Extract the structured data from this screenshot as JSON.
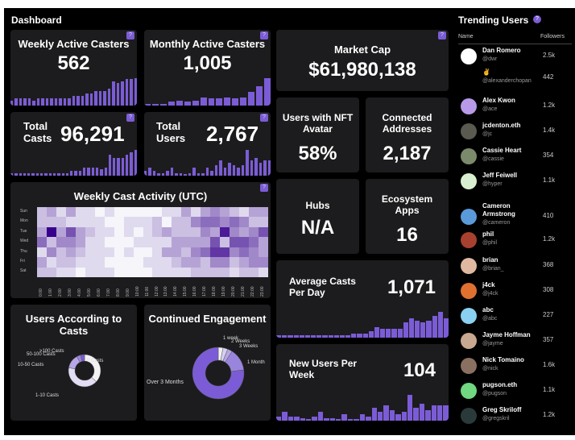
{
  "title": "Dashboard",
  "accent": "#7b5cd6",
  "help_label": "?",
  "cards": {
    "weekly_active": {
      "label": "Weekly Active Casters",
      "value": "562",
      "bars": [
        2,
        3,
        3,
        3,
        3,
        2,
        3,
        3,
        3,
        3,
        3,
        3,
        3,
        3,
        4,
        4,
        4,
        5,
        5,
        6,
        6,
        6,
        7,
        10,
        9.5,
        10,
        11,
        11,
        11.5
      ]
    },
    "monthly_active": {
      "label": "Monthly Active Casters",
      "value": "1,005",
      "bars": [
        0.1,
        0.1,
        0.1,
        1,
        1.2,
        1,
        1.2,
        2,
        1.8,
        1.8,
        2,
        1.8,
        2,
        3.5,
        5,
        7
      ]
    },
    "total_casts": {
      "label": "Total Casts",
      "value": "96,291",
      "bars": [
        1,
        1,
        1,
        1,
        1,
        1,
        1,
        1,
        1,
        1,
        1,
        1,
        1,
        1,
        2,
        2,
        2,
        3,
        3,
        3,
        3,
        2.5,
        3,
        8,
        7,
        7,
        7,
        8,
        9,
        10
      ]
    },
    "total_users": {
      "label": "Total Users",
      "value": "2,767",
      "bars": [
        2,
        3,
        2,
        1,
        1,
        2,
        3,
        1,
        1,
        0.3,
        1,
        3,
        1,
        1,
        3,
        2,
        4,
        6,
        3,
        5,
        4,
        3,
        4,
        10,
        6,
        7,
        5,
        6,
        6
      ]
    },
    "market_cap": {
      "label": "Market Cap",
      "value": "$61,980,138"
    },
    "nft_avatar": {
      "label": "Users with NFT Avatar",
      "value": "58%"
    },
    "connected": {
      "label": "Connected Addresses",
      "value": "2,187"
    },
    "hubs": {
      "label": "Hubs",
      "value": "N/A"
    },
    "eco_apps": {
      "label": "Ecosystem Apps",
      "value": "16"
    },
    "avg_casts": {
      "label": "Average Casts Per Day",
      "value": "1,071",
      "bars": [
        1,
        1,
        1,
        1,
        1,
        1,
        1,
        1,
        1,
        1,
        1,
        1,
        1,
        2,
        2,
        2,
        3,
        5,
        4,
        4,
        4,
        4,
        7,
        9,
        8,
        7,
        8,
        10,
        12,
        9
      ]
    },
    "new_users": {
      "label": "New Users Per Week",
      "value": "104",
      "bars": [
        2,
        4,
        2,
        2,
        1,
        0.5,
        2,
        4,
        1,
        1,
        0.3,
        3,
        0.5,
        0.5,
        3,
        2,
        6,
        4,
        7,
        5,
        3,
        4,
        12,
        6,
        8,
        5,
        7,
        7,
        7
      ]
    }
  },
  "chart_data": [
    {
      "type": "heatmap",
      "title": "Weekly Cast Activity (UTC)",
      "rows": [
        "Sun",
        "Mon",
        "Tue",
        "Wed",
        "Thu",
        "Fri",
        "Sat"
      ],
      "columns": [
        "0:00",
        "1:00",
        "2:00",
        "3:00",
        "4:00",
        "5:00",
        "6:00",
        "7:00",
        "8:00",
        "9:00",
        "10:00",
        "11:00",
        "12:00",
        "13:00",
        "14:00",
        "15:00",
        "16:00",
        "17:00",
        "18:00",
        "19:00",
        "20:00",
        "21:00",
        "22:00",
        "23:00"
      ],
      "values": [
        [
          2,
          3,
          1,
          3,
          1,
          1,
          0,
          1,
          0,
          0,
          0,
          0,
          0,
          1,
          1,
          3,
          1,
          3,
          4,
          3,
          2,
          1,
          3,
          3
        ],
        [
          2,
          2,
          2,
          1,
          1,
          1,
          1,
          0,
          0,
          1,
          1,
          1,
          2,
          0,
          2,
          2,
          4,
          5,
          5,
          4,
          5,
          4,
          2,
          2
        ],
        [
          3,
          9,
          3,
          6,
          3,
          2,
          1,
          1,
          0,
          1,
          0,
          1,
          2,
          3,
          2,
          2,
          2,
          4,
          3,
          8,
          4,
          3,
          4,
          6
        ],
        [
          5,
          2,
          4,
          4,
          3,
          1,
          1,
          0,
          0,
          0,
          1,
          1,
          1,
          1,
          3,
          3,
          3,
          3,
          6,
          2,
          6,
          6,
          5,
          3
        ],
        [
          1,
          4,
          2,
          3,
          2,
          1,
          1,
          1,
          0,
          1,
          0,
          0,
          1,
          3,
          3,
          2,
          4,
          5,
          7,
          7,
          4,
          5,
          4,
          3
        ],
        [
          3,
          1,
          2,
          2,
          1,
          1,
          1,
          0,
          0,
          0,
          0,
          1,
          1,
          1,
          2,
          3,
          3,
          2,
          4,
          4,
          2,
          3,
          4,
          4
        ],
        [
          2,
          2,
          1,
          1,
          0,
          1,
          1,
          1,
          0,
          0,
          0,
          0,
          1,
          1,
          1,
          1,
          2,
          2,
          2,
          2,
          1,
          2,
          2,
          1
        ]
      ]
    },
    {
      "type": "pie",
      "title": "Users According to Casts",
      "categories": [
        "0 Casts",
        "1-10 Casts",
        "10-50 Casts",
        "50-100 Casts",
        ">100 Casts"
      ],
      "values": [
        37,
        41,
        14,
        4,
        4
      ],
      "colors": [
        "#f2f2f4",
        "#e2dcf5",
        "#b7a6e6",
        "#9a85dc",
        "#7b5cd6"
      ]
    },
    {
      "type": "pie",
      "title": "Continued Engagement",
      "categories": [
        "1 week",
        "2 Weeks",
        "3 Weeks",
        "1 Month",
        "Over 3 Months"
      ],
      "values": [
        3,
        3,
        3,
        14,
        77
      ],
      "colors": [
        "#f2f2f4",
        "#d8cff2",
        "#b7a6e6",
        "#9a85dc",
        "#7b5cd6"
      ]
    }
  ],
  "trending": {
    "title": "Trending Users",
    "col_name": "Name",
    "col_followers": "Followers",
    "users": [
      {
        "name": "Dan Romero",
        "handle": "@dwr",
        "followers": "2.5k",
        "color": "#ffffff"
      },
      {
        "name": "✌",
        "handle": "@alexanderchopan",
        "followers": "442",
        "color": "#000000"
      },
      {
        "name": "Alex Kwon",
        "handle": "@ace",
        "followers": "1.2k",
        "color": "#b89ae8"
      },
      {
        "name": "jcdenton.eth",
        "handle": "@jc",
        "followers": "1.4k",
        "color": "#5a5a50"
      },
      {
        "name": "Cassie Heart",
        "handle": "@cassie",
        "followers": "354",
        "color": "#7a8a6a"
      },
      {
        "name": "Jeff Feiwell",
        "handle": "@hyper",
        "followers": "1.1k",
        "color": "#d8f0d0"
      },
      {
        "name": "Cameron Armstrong",
        "handle": "@cameron",
        "followers": "410",
        "color": "#5a9ad8"
      },
      {
        "name": "phil",
        "handle": "@phil",
        "followers": "1.2k",
        "color": "#a84030"
      },
      {
        "name": "brian",
        "handle": "@brian_",
        "followers": "368",
        "color": "#e0b8a0"
      },
      {
        "name": "j4ck",
        "handle": "@j4ck",
        "followers": "308",
        "color": "#e07030"
      },
      {
        "name": "abc",
        "handle": "@abc",
        "followers": "227",
        "color": "#8ad0f0"
      },
      {
        "name": "Jayme Hoffman",
        "handle": "@jayme",
        "followers": "357",
        "color": "#c8a890"
      },
      {
        "name": "Nick Tomaino",
        "handle": "@nick",
        "followers": "1.6k",
        "color": "#8a7060"
      },
      {
        "name": "pugson.eth",
        "handle": "@pugson",
        "followers": "1.1k",
        "color": "#70d880"
      },
      {
        "name": "Greg Skriloff",
        "handle": "@gregskril",
        "followers": "1.2k",
        "color": "#2a3a3a"
      }
    ]
  }
}
